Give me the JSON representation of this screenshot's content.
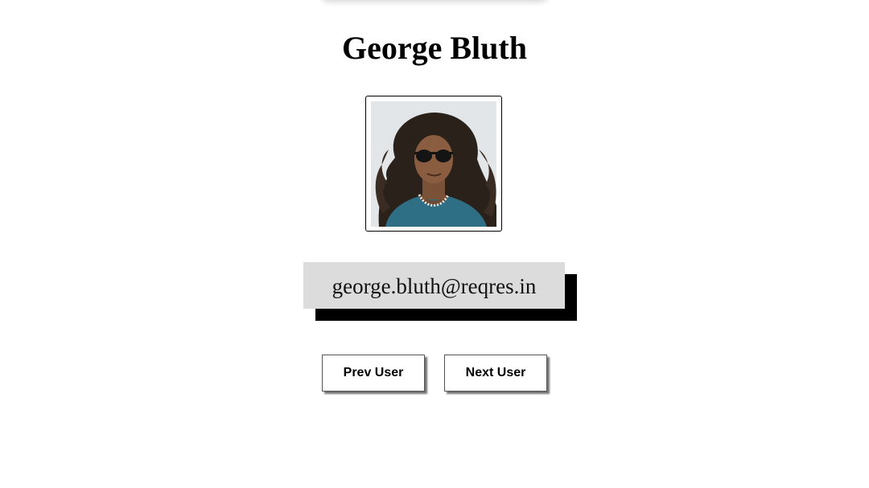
{
  "user": {
    "name": "George Bluth",
    "email": "george.bluth@reqres.in"
  },
  "nav": {
    "prev_label": "Prev User",
    "next_label": "Next User"
  }
}
